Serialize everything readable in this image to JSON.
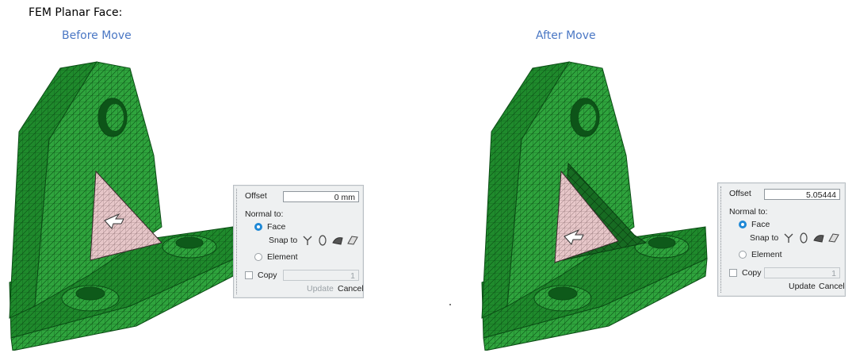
{
  "heading": "FEM Planar Face:",
  "captions": {
    "before": "Before Move",
    "after": "After Move"
  },
  "colors": {
    "mesh_green": "#1f8a2c",
    "face_pink": "#e6c6c8",
    "caption_blue": "#4a77c4",
    "radio_blue": "#1e88d6"
  },
  "panel_before": {
    "offset_label": "Offset",
    "offset_value": "0 mm",
    "normal_label": "Normal to:",
    "face_label": "Face",
    "snap_label": "Snap to",
    "element_label": "Element",
    "copy_label": "Copy",
    "copy_value": "1",
    "update_label": "Update",
    "cancel_label": "Cancel",
    "selected": "Face",
    "update_enabled": false
  },
  "panel_after": {
    "offset_label": "Offset",
    "offset_value": "5.05444",
    "normal_label": "Normal to:",
    "face_label": "Face",
    "snap_label": "Snap to",
    "element_label": "Element",
    "copy_label": "Copy",
    "copy_value": "1",
    "update_label": "Update",
    "cancel_label": "Cancel",
    "selected": "Face",
    "update_enabled": true
  },
  "snap_icons": [
    "y-axis-icon",
    "ellipse-icon",
    "surface-icon",
    "plane-icon"
  ]
}
